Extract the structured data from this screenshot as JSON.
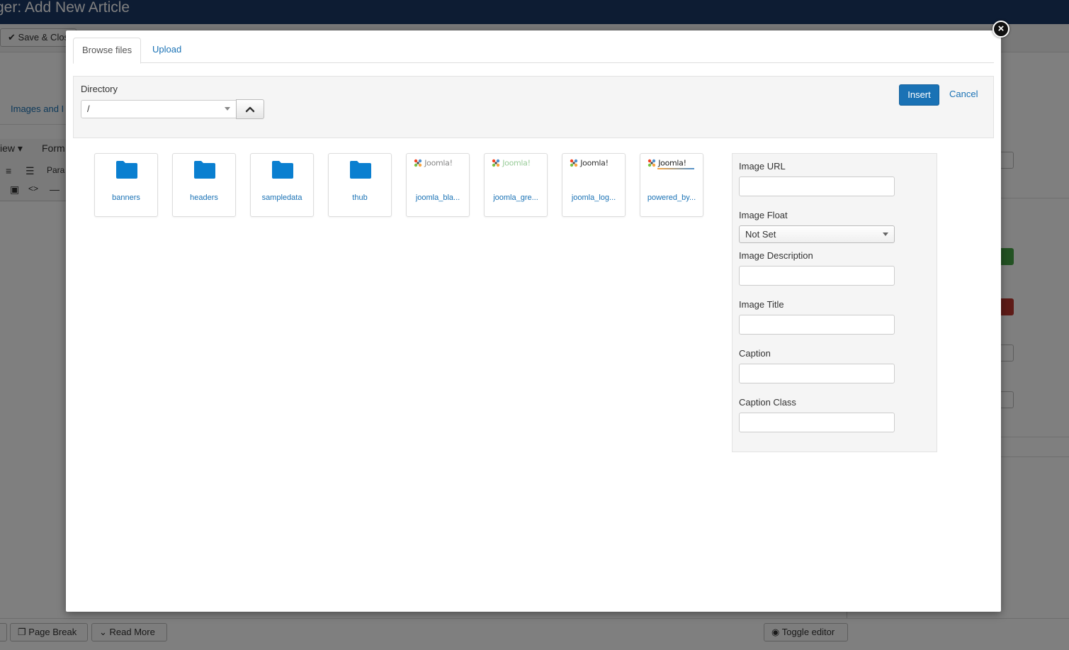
{
  "background": {
    "page_title": "ger: Add New Article",
    "toolbar": {
      "save_close_label": "Save & Clos"
    },
    "tab_images_label": "Images and I",
    "editor_menu": {
      "view_label": "iew",
      "format_label": "Form",
      "paragraph_label": "Para"
    },
    "footer_buttons": {
      "page_break_label": "Page Break",
      "read_more_label": "Read More",
      "toggle_editor_label": "Toggle editor"
    }
  },
  "modal": {
    "tabs": [
      {
        "label": "Browse files",
        "active": true
      },
      {
        "label": "Upload",
        "active": false
      }
    ],
    "directory": {
      "label": "Directory",
      "selected": "/"
    },
    "actions": {
      "insert_label": "Insert",
      "cancel_label": "Cancel"
    },
    "items": [
      {
        "type": "folder",
        "label": "banners"
      },
      {
        "type": "folder",
        "label": "headers"
      },
      {
        "type": "folder",
        "label": "sampledata"
      },
      {
        "type": "folder",
        "label": "thub"
      },
      {
        "type": "image",
        "label": "joomla_bla..."
      },
      {
        "type": "image",
        "label": "joomla_gre..."
      },
      {
        "type": "image",
        "label": "joomla_log..."
      },
      {
        "type": "image",
        "label": "powered_by..."
      }
    ],
    "logo_text": "Joomla!",
    "fields": {
      "image_url": {
        "label": "Image URL",
        "value": ""
      },
      "image_float": {
        "label": "Image Float",
        "selected": "Not Set"
      },
      "image_description": {
        "label": "Image Description",
        "value": ""
      },
      "image_title": {
        "label": "Image Title",
        "value": ""
      },
      "caption": {
        "label": "Caption",
        "value": ""
      },
      "caption_class": {
        "label": "Caption Class",
        "value": ""
      }
    }
  },
  "colors": {
    "accent": "#1a72b5",
    "folder": "#0a7fd0",
    "header_bar": "#1a3867"
  }
}
